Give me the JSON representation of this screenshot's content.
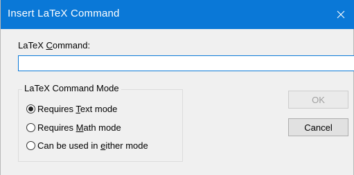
{
  "window": {
    "title": "Insert LaTeX Command",
    "close_icon": "close-icon",
    "titlebar_color": "#0a78d7"
  },
  "command_field": {
    "label_pre": "LaTeX ",
    "label_mnemonic": "C",
    "label_post": "ommand:",
    "value": "",
    "placeholder": ""
  },
  "mode_group": {
    "legend": "LaTeX Command Mode",
    "options": [
      {
        "pre": "Requires ",
        "mnemonic": "T",
        "post": "ext mode",
        "selected": true
      },
      {
        "pre": "Requires ",
        "mnemonic": "M",
        "post": "ath mode",
        "selected": false
      },
      {
        "pre": "Can be used in ",
        "mnemonic": "e",
        "post": "ither mode",
        "selected": false
      }
    ]
  },
  "buttons": {
    "ok": {
      "label": "OK",
      "enabled": false
    },
    "cancel": {
      "label": "Cancel",
      "enabled": true
    }
  }
}
